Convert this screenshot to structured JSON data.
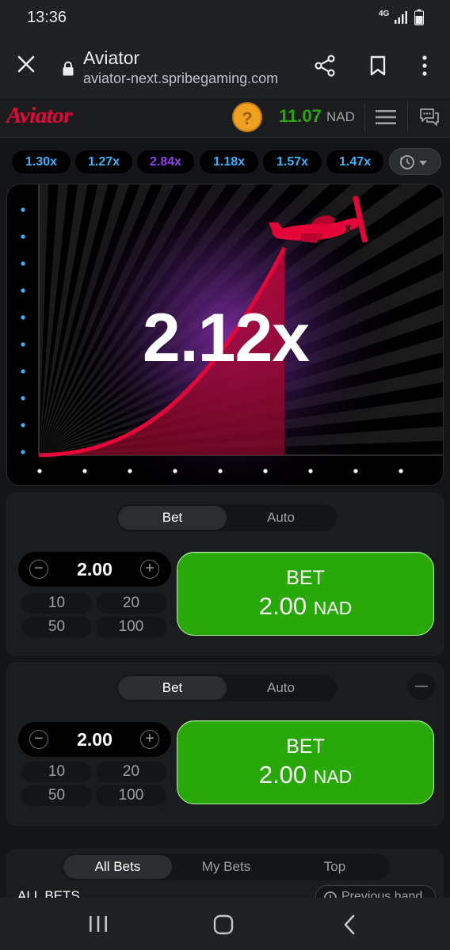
{
  "status_bar": {
    "time": "13:36",
    "network": "4G"
  },
  "browser": {
    "title": "Aviator",
    "url": "aviator-next.spribegaming.com"
  },
  "header": {
    "logo": "Aviator",
    "help_symbol": "?",
    "balance": "11.07",
    "currency": "NAD"
  },
  "history": {
    "multipliers": [
      {
        "value": "1.30x",
        "color": "#34b4ff"
      },
      {
        "value": "1.27x",
        "color": "#34b4ff"
      },
      {
        "value": "2.84x",
        "color": "#913ef8"
      },
      {
        "value": "1.18x",
        "color": "#34b4ff"
      },
      {
        "value": "1.57x",
        "color": "#34b4ff"
      },
      {
        "value": "1.47x",
        "color": "#34b4ff"
      }
    ]
  },
  "game": {
    "multiplier": "2.12x",
    "accent": "#e50539"
  },
  "bet_panels": [
    {
      "tab_bet": "Bet",
      "tab_auto": "Auto",
      "amount": "2.00",
      "quick": [
        "10",
        "20",
        "50",
        "100"
      ],
      "button_label": "BET",
      "button_amount": "2.00",
      "button_currency": "NAD"
    },
    {
      "tab_bet": "Bet",
      "tab_auto": "Auto",
      "amount": "2.00",
      "quick": [
        "10",
        "20",
        "50",
        "100"
      ],
      "button_label": "BET",
      "button_amount": "2.00",
      "button_currency": "NAD"
    }
  ],
  "bets_list": {
    "tabs": [
      "All Bets",
      "My Bets",
      "Top"
    ],
    "section_label": "ALL BETS",
    "previous_hand": "Previous hand"
  }
}
